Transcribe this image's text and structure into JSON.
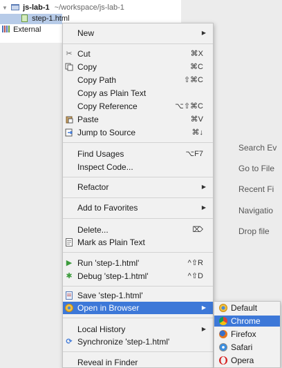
{
  "project_tree": {
    "project_name": "js-lab-1",
    "project_path": "~/workspace/js-lab-1",
    "selected_file": "step-1.html",
    "external_libraries": "External"
  },
  "editor_hints": [
    "Search Ev",
    "Go to File",
    "Recent Fi",
    "Navigatio",
    "Drop file"
  ],
  "context_menu": {
    "new": "New",
    "cut": "Cut",
    "cut_shortcut": "⌘X",
    "copy": "Copy",
    "copy_shortcut": "⌘C",
    "copy_path": "Copy Path",
    "copy_path_shortcut": "⇧⌘C",
    "copy_plain": "Copy as Plain Text",
    "copy_reference": "Copy Reference",
    "copy_reference_shortcut": "⌥⇧⌘C",
    "paste": "Paste",
    "paste_shortcut": "⌘V",
    "jump_source": "Jump to Source",
    "jump_source_shortcut": "⌘↓",
    "find_usages": "Find Usages",
    "find_usages_shortcut": "⌥F7",
    "inspect_code": "Inspect Code...",
    "refactor": "Refactor",
    "add_favorites": "Add to Favorites",
    "delete": "Delete...",
    "delete_shortcut": "⌦",
    "mark_plain": "Mark as Plain Text",
    "run": "Run 'step-1.html'",
    "run_shortcut": "^⇧R",
    "debug": "Debug 'step-1.html'",
    "debug_shortcut": "^⇧D",
    "save": "Save 'step-1.html'",
    "open_browser": "Open in Browser",
    "local_history": "Local History",
    "synchronize": "Synchronize 'step-1.html'",
    "reveal_finder": "Reveal in Finder"
  },
  "browser_submenu": {
    "default": "Default",
    "chrome": "Chrome",
    "firefox": "Firefox",
    "safari": "Safari",
    "opera": "Opera"
  },
  "colors": {
    "highlight": "#3d78d8",
    "menu_bg": "#f1f1f1",
    "panel_bg": "#ffffff",
    "editor_bg": "#ececec"
  }
}
